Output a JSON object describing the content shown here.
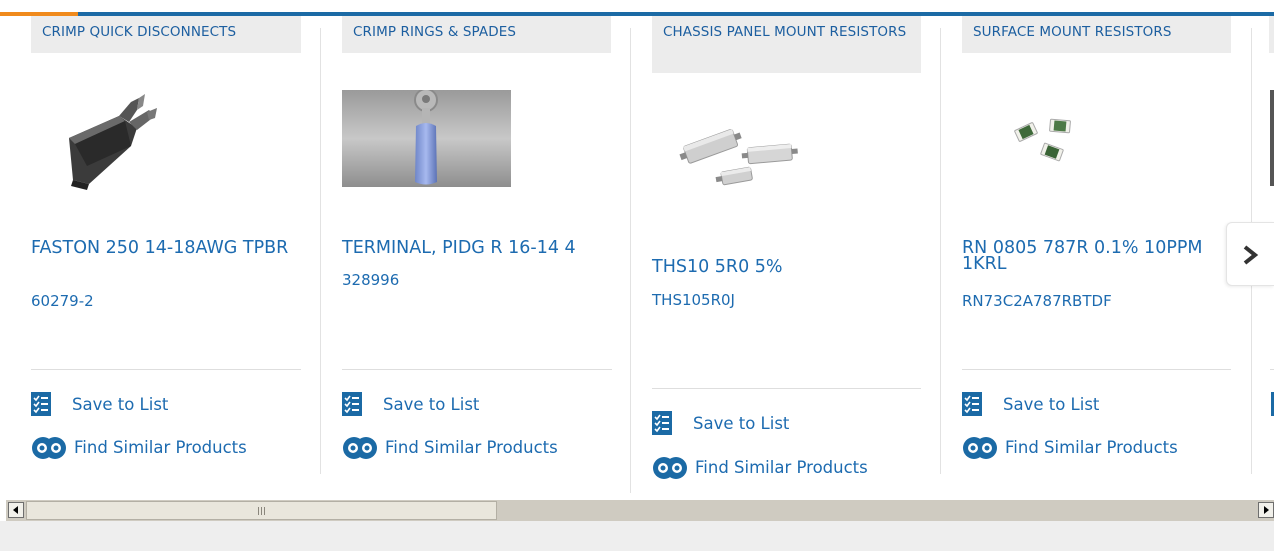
{
  "cards": [
    {
      "category": "CRIMP QUICK DISCONNECTS",
      "title": "FASTON 250 14-18AWG TPBR",
      "part_number": "60279-2",
      "save_label": "Save to List",
      "find_label": "Find Similar Products",
      "image_icon": "quick-disconnect-terminal"
    },
    {
      "category": "CRIMP RINGS & SPADES",
      "title": "TERMINAL, PIDG R 16-14 4",
      "part_number": "328996",
      "save_label": "Save to List",
      "find_label": "Find Similar Products",
      "image_icon": "ring-terminal"
    },
    {
      "category": "CHASSIS PANEL MOUNT RESISTORS",
      "title": "THS10 5R0 5%",
      "part_number": "THS105R0J",
      "save_label": "Save to List",
      "find_label": "Find Similar Products",
      "image_icon": "chassis-resistors"
    },
    {
      "category": "SURFACE MOUNT RESISTORS",
      "title": "RN 0805 787R 0.1% 10PPM 1KRL",
      "part_number": "RN73C2A787RBTDF",
      "save_label": "Save to List",
      "find_label": "Find Similar Products",
      "image_icon": "smd-resistors"
    }
  ],
  "navigation": {
    "next_icon": "chevron-right-icon"
  },
  "scrollbar": {
    "left_icon": "triangle-left-icon",
    "right_icon": "triangle-right-icon"
  },
  "colors": {
    "brand_blue": "#1b6aa5",
    "link_blue": "#1d6bb0",
    "accent_orange": "#f08a1c",
    "category_bg": "#ececec"
  }
}
